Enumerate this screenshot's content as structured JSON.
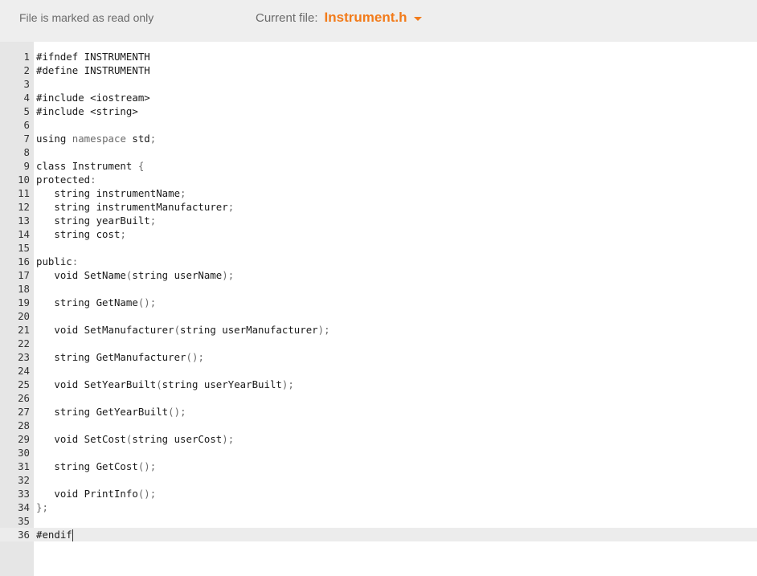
{
  "header": {
    "readonly_notice": "File is marked as read only",
    "current_file_label": "Current file:",
    "current_file_name": "Instrument.h",
    "accent_color": "#f27b1a"
  },
  "editor": {
    "active_line": 36,
    "lines": [
      "#ifndef INSTRUMENTH",
      "#define INSTRUMENTH",
      "",
      "#include <iostream>",
      "#include <string>",
      "",
      "using namespace std;",
      "",
      "class Instrument {",
      "protected:",
      "   string instrumentName;",
      "   string instrumentManufacturer;",
      "   string yearBuilt;",
      "   string cost;",
      "",
      "public:",
      "   void SetName(string userName);",
      "",
      "   string GetName();",
      "",
      "   void SetManufacturer(string userManufacturer);",
      "",
      "   string GetManufacturer();",
      "",
      "   void SetYearBuilt(string userYearBuilt);",
      "",
      "   string GetYearBuilt();",
      "",
      "   void SetCost(string userCost);",
      "",
      "   string GetCost();",
      "",
      "   void PrintInfo();",
      "};",
      "",
      "#endif"
    ]
  }
}
